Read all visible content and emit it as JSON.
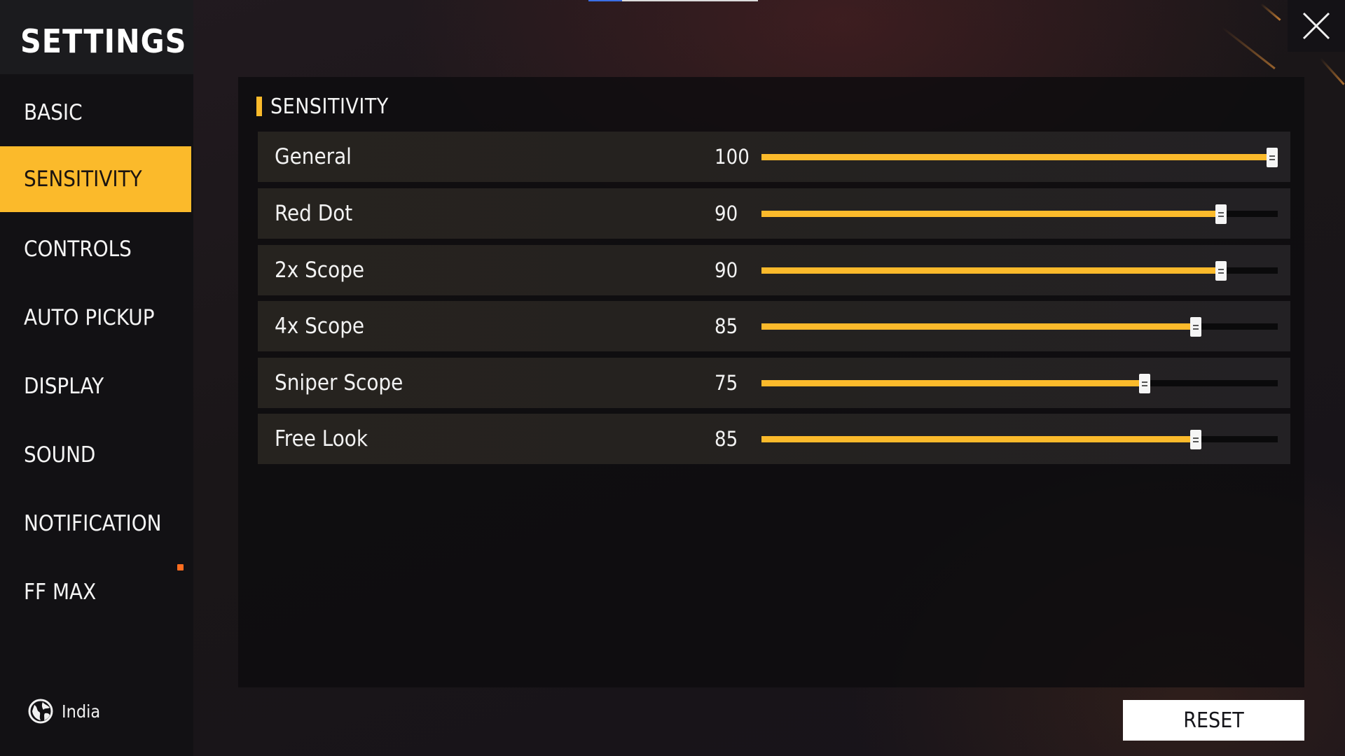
{
  "sidebar": {
    "title": "SETTINGS",
    "items": [
      {
        "label": "BASIC",
        "active": false
      },
      {
        "label": "SENSITIVITY",
        "active": true
      },
      {
        "label": "CONTROLS",
        "active": false
      },
      {
        "label": "AUTO PICKUP",
        "active": false
      },
      {
        "label": "DISPLAY",
        "active": false
      },
      {
        "label": "SOUND",
        "active": false
      },
      {
        "label": "NOTIFICATION",
        "active": false
      },
      {
        "label": "FF MAX",
        "active": false
      }
    ],
    "region": {
      "label": "India",
      "icon": "globe-icon"
    }
  },
  "panel": {
    "title": "SENSITIVITY",
    "rows": [
      {
        "label": "General",
        "value": "100",
        "percent": 100
      },
      {
        "label": "Red Dot",
        "value": "90",
        "percent": 90
      },
      {
        "label": "2x Scope",
        "value": "90",
        "percent": 90
      },
      {
        "label": "4x Scope",
        "value": "85",
        "percent": 85
      },
      {
        "label": "Sniper Scope",
        "value": "75",
        "percent": 75
      },
      {
        "label": "Free Look",
        "value": "85",
        "percent": 85
      }
    ]
  },
  "actions": {
    "reset_label": "RESET",
    "close_icon": "close-icon"
  },
  "colors": {
    "accent": "#fbba2b",
    "track": "#0a0a0b",
    "sidebar_bg": "#121114",
    "notification_dot": "#ff6d1f",
    "reset_bg": "#ffffff"
  }
}
